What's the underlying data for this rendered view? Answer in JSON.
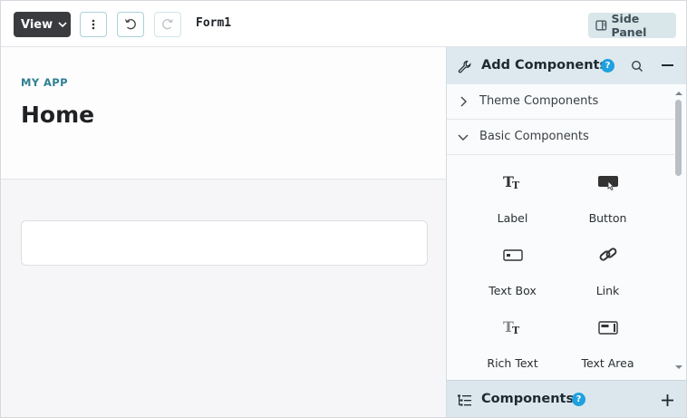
{
  "toolbar": {
    "view_label": "View",
    "form_name": "Form1",
    "side_panel_label": "Side Panel"
  },
  "canvas": {
    "app_label": "MY APP",
    "page_title": "Home"
  },
  "panel": {
    "title": "Add Components",
    "help": "?",
    "sections": [
      {
        "label": "Theme Components",
        "expanded": false
      },
      {
        "label": "Basic Components",
        "expanded": true
      }
    ],
    "items": [
      {
        "label": "Label",
        "icon": "label-text-icon"
      },
      {
        "label": "Button",
        "icon": "button-icon"
      },
      {
        "label": "Text Box",
        "icon": "textbox-icon"
      },
      {
        "label": "Link",
        "icon": "link-icon"
      },
      {
        "label": "Rich Text",
        "icon": "rich-text-icon"
      },
      {
        "label": "Text Area",
        "icon": "text-area-icon"
      }
    ],
    "components_title": "Components",
    "components_help": "?"
  },
  "colors": {
    "accent": "#2f7f93",
    "help_blue": "#1fa0e0",
    "panel_header": "#dde9ee"
  }
}
